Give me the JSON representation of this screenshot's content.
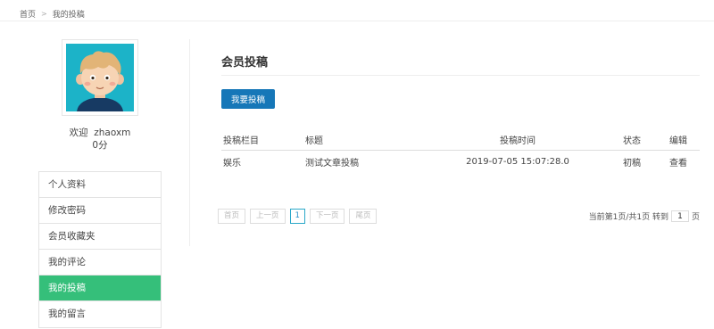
{
  "breadcrumb": {
    "home": "首页",
    "separator": ">",
    "current": "我的投稿"
  },
  "sidebar": {
    "welcome_prefix": "欢迎",
    "username": "zhaoxm",
    "points": "0分",
    "items": [
      {
        "label": "个人资料"
      },
      {
        "label": "修改密码"
      },
      {
        "label": "会员收藏夹"
      },
      {
        "label": "我的评论"
      },
      {
        "label": "我的投稿",
        "active": true
      },
      {
        "label": "我的留言"
      }
    ]
  },
  "main": {
    "title": "会员投稿",
    "submit_button": "我要投稿",
    "table": {
      "headers": [
        "投稿栏目",
        "标题",
        "投稿时间",
        "状态",
        "编辑"
      ],
      "rows": [
        [
          "娱乐",
          "测试文章投稿",
          "2019-07-05 15:07:28.0",
          "初稿",
          "查看"
        ]
      ]
    },
    "pager": {
      "first": "首页",
      "prev": "上一页",
      "current": "1",
      "next": "下一页",
      "last": "尾页",
      "info": "当前第1页/共1页 转到",
      "goto_value": "1",
      "suffix": "页"
    }
  },
  "colors": {
    "accent_green": "#35bf7a",
    "button_blue": "#1677b8",
    "avatar_bg": "#1cb3c8"
  },
  "icons": {
    "avatar": "cartoon-boy-avatar"
  }
}
